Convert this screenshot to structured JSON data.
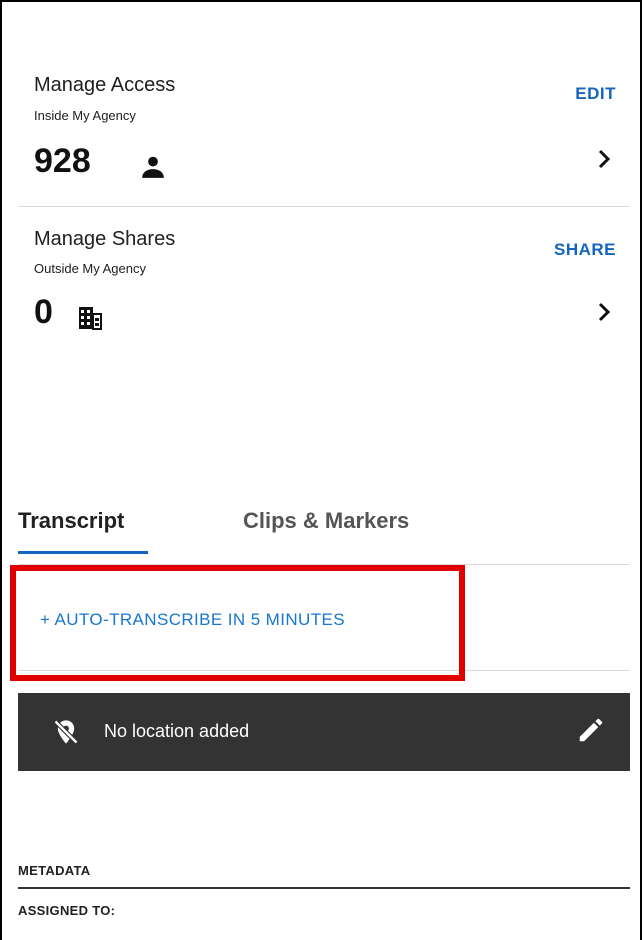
{
  "access": {
    "title": "Manage Access",
    "subtitle": "Inside My Agency",
    "count": "928",
    "action": "EDIT",
    "icon": "person-icon"
  },
  "shares": {
    "title": "Manage Shares",
    "subtitle": "Outside My Agency",
    "count": "0",
    "action": "SHARE",
    "icon": "building-icon"
  },
  "tabs": [
    {
      "label": "Transcript",
      "active": true
    },
    {
      "label": "Clips & Markers",
      "active": false
    }
  ],
  "transcribe": {
    "label": "+ AUTO-TRANSCRIBE IN 5 MINUTES"
  },
  "location": {
    "text": "No location added",
    "icon": "location-off-icon",
    "edit_icon": "pencil-icon"
  },
  "metadata": {
    "heading": "METADATA",
    "assigned_label": "ASSIGNED TO:"
  },
  "colors": {
    "accent": "#1565c0",
    "highlight": "#e00000",
    "location_bar": "#333333"
  }
}
